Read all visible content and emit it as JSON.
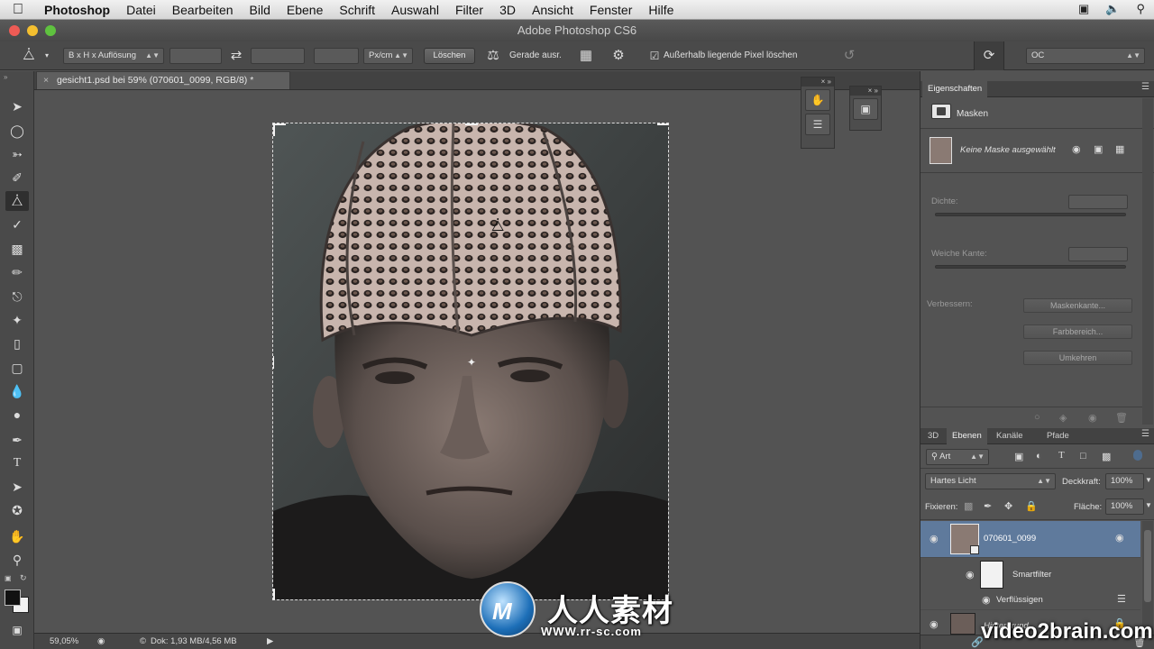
{
  "menubar": {
    "app_name": "Photoshop",
    "items": [
      "Datei",
      "Bearbeiten",
      "Bild",
      "Ebene",
      "Schrift",
      "Auswahl",
      "Filter",
      "3D",
      "Ansicht",
      "Fenster",
      "Hilfe"
    ]
  },
  "window": {
    "title": "Adobe Photoshop CS6"
  },
  "options_bar": {
    "ratio_select": "B x H x Auflösung",
    "unit_select": "Px/cm",
    "clear_button": "Löschen",
    "straighten_label": "Gerade ausr.",
    "delete_cropped_label": "Außerhalb liegende Pixel löschen",
    "delete_cropped_checked": true,
    "workspace_select": "OC"
  },
  "document": {
    "tab_title": "gesicht1.psd bei 59% (070601_0099, RGB/8) *",
    "close_glyph": "×"
  },
  "status_bar": {
    "zoom": "59,05%",
    "doc_info": "Dok: 1,93 MB/4,56 MB"
  },
  "properties_panel": {
    "tab": "Eigenschaften",
    "section": "Masken",
    "no_mask": "Keine Maske ausgewählt",
    "density_label": "Dichte:",
    "feather_label": "Weiche Kante:",
    "refine_label": "Verbessern:",
    "buttons": [
      "Maskenkante...",
      "Farbbereich...",
      "Umkehren"
    ]
  },
  "layers_panel": {
    "tabs": [
      "3D",
      "Ebenen",
      "Kanäle",
      "Pfade"
    ],
    "active_tab": "Ebenen",
    "filter_kind": "Art",
    "blend_mode": "Hartes Licht",
    "opacity_label": "Deckkraft:",
    "opacity_value": "100%",
    "lock_label": "Fixieren:",
    "fill_label": "Fläche:",
    "fill_value": "100%",
    "layers": [
      {
        "name": "070601_0099",
        "selected": true
      },
      {
        "name": "Smartfilter",
        "selected": false
      },
      {
        "name": "Verflüssigen",
        "selected": false
      },
      {
        "name": "Hintergrund",
        "selected": false
      }
    ]
  },
  "watermark": {
    "main": "人人素材",
    "url": "WWW.rr-sc.com",
    "brand": "video2brain.com"
  },
  "colors": {
    "panel_bg": "#535353",
    "selected_layer": "#5f7a9c",
    "menubar": "#e4e4e4"
  }
}
